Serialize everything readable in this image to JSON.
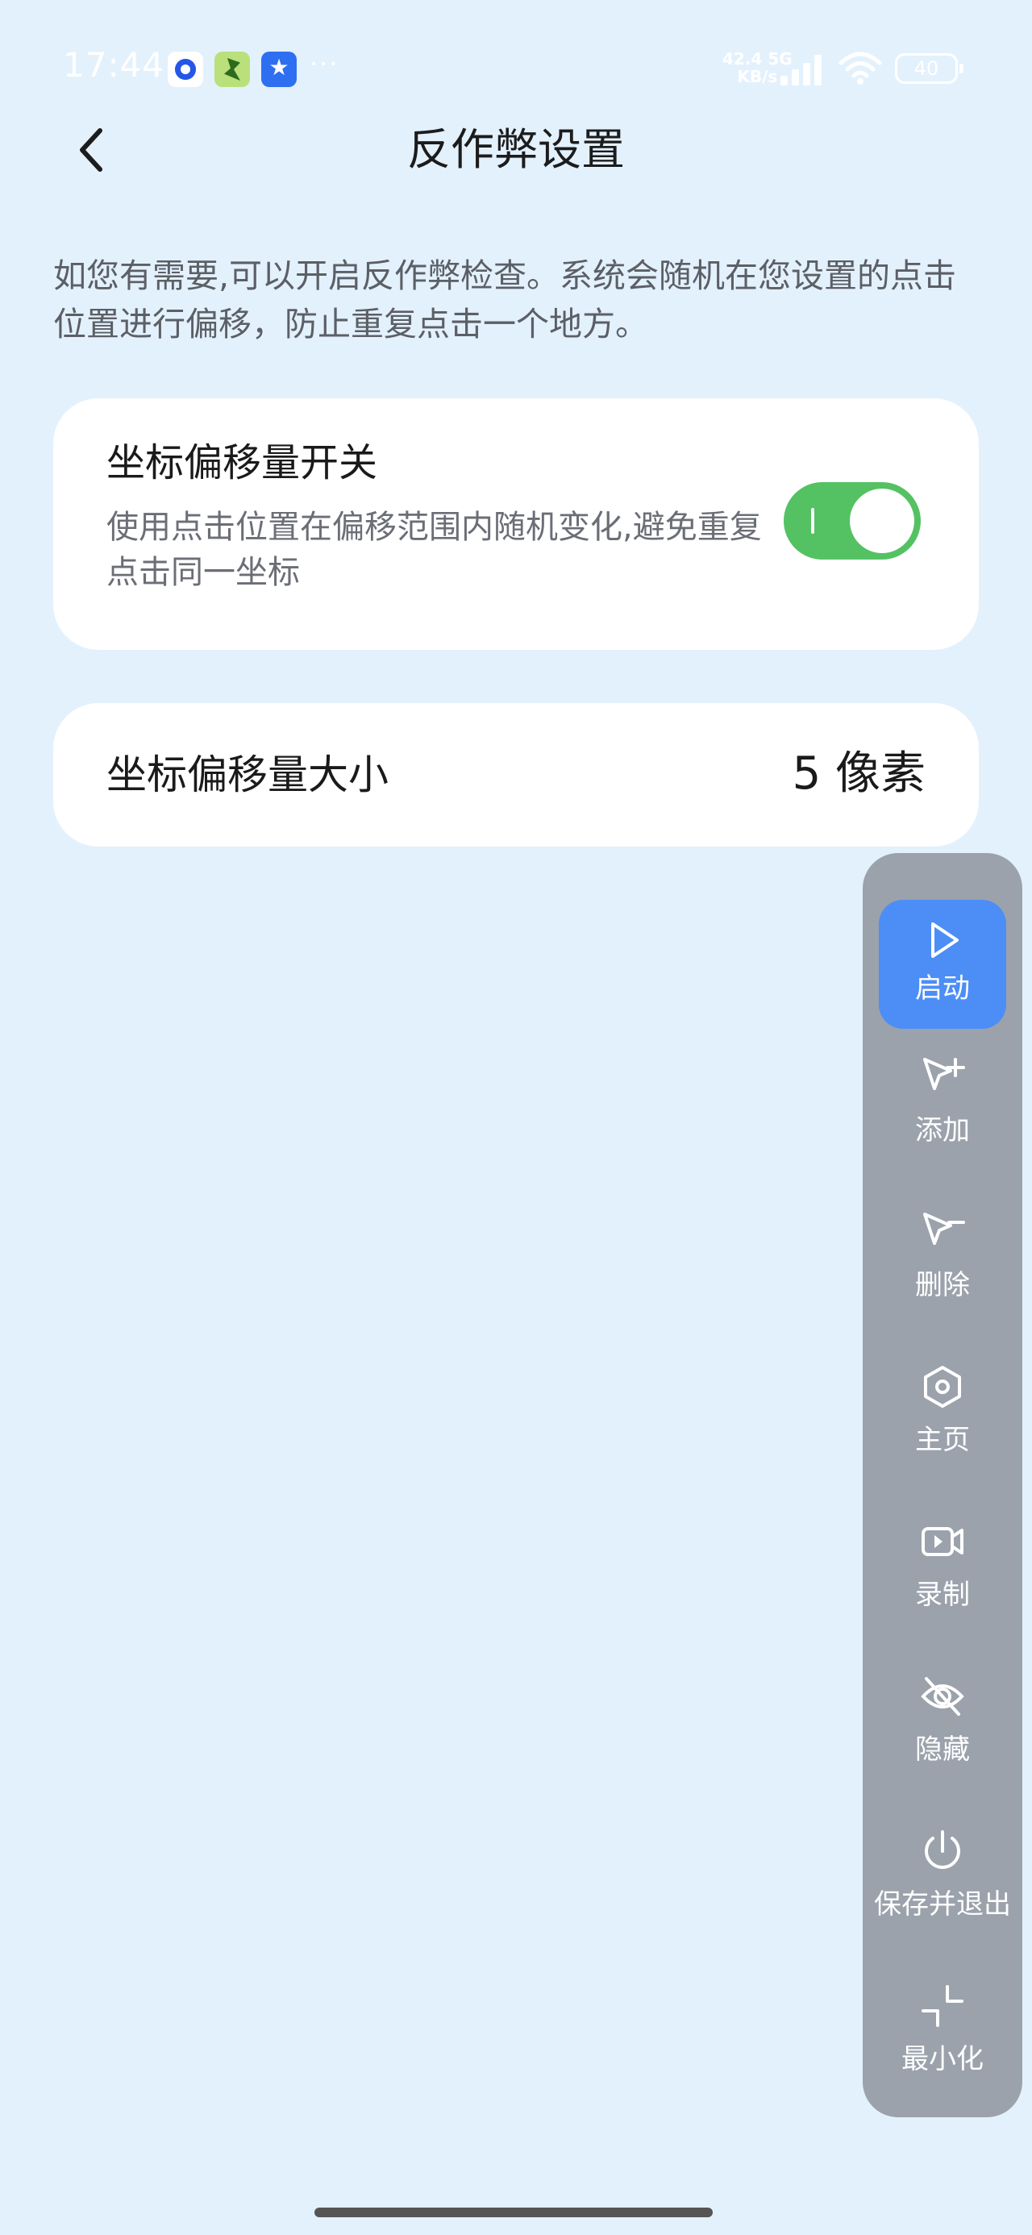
{
  "status_bar": {
    "time": "17:44",
    "network_speed": "42.4",
    "network_unit": "KB/s",
    "network_type": "5G",
    "battery": "40",
    "overflow": "···"
  },
  "header": {
    "title": "反作弊设置",
    "back_icon": "chevron-left-icon"
  },
  "description": "如您有需要,可以开启反作弊检查。系统会随机在您设置的点击位置进行偏移，防止重复点击一个地方。",
  "offset_switch": {
    "title": "坐标偏移量开关",
    "subtitle": "使用点击位置在偏移范围内随机变化,避免重复点击同一坐标",
    "enabled": true,
    "on_color": "#54c263"
  },
  "offset_size": {
    "title": "坐标偏移量大小",
    "value": "5 像素"
  },
  "float_panel": {
    "accent": "#4c8ef6",
    "background": "#9ba2ac",
    "items": [
      {
        "label": "启动",
        "icon": "play-icon",
        "active": true
      },
      {
        "label": "添加",
        "icon": "cursor-add-icon"
      },
      {
        "label": "删除",
        "icon": "cursor-remove-icon"
      },
      {
        "label": "主页",
        "icon": "hexagon-home-icon"
      },
      {
        "label": "录制",
        "icon": "video-record-icon"
      },
      {
        "label": "隐藏",
        "icon": "eye-off-icon"
      },
      {
        "label": "保存并退出",
        "icon": "power-icon"
      },
      {
        "label": "最小化",
        "icon": "minimize-icon"
      }
    ]
  }
}
